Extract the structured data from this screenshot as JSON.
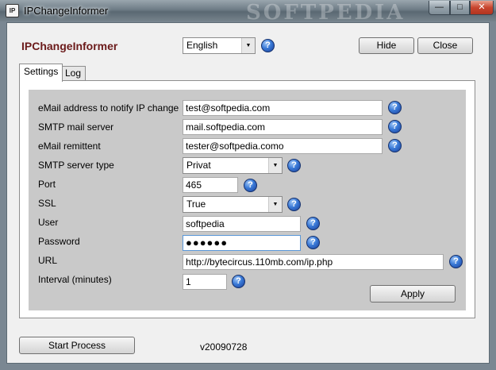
{
  "window": {
    "title": "IPChangeInformer",
    "icon_text": "IP",
    "watermark": "SOFTPEDIA",
    "minimize_glyph": "—",
    "maximize_glyph": "□",
    "close_glyph": "✕"
  },
  "header": {
    "app_title": "IPChangeInformer",
    "language": {
      "selected": "English"
    },
    "hide_label": "Hide",
    "close_label": "Close"
  },
  "tabs": [
    {
      "label": "Settings",
      "active": true
    },
    {
      "label": "Log",
      "active": false
    }
  ],
  "form": {
    "email_notify": {
      "label": "eMail address to notify IP change",
      "value": "test@softpedia.com"
    },
    "smtp_server": {
      "label": "SMTP mail server",
      "value": "mail.softpedia.com"
    },
    "email_remittent": {
      "label": "eMail remittent",
      "value": "tester@softpedia.como"
    },
    "smtp_type": {
      "label": "SMTP server type",
      "selected": "Privat"
    },
    "port": {
      "label": "Port",
      "value": "465"
    },
    "ssl": {
      "label": "SSL",
      "selected": "True"
    },
    "user": {
      "label": "User",
      "value": "softpedia"
    },
    "password": {
      "label": "Password",
      "value": "●●●●●●"
    },
    "url": {
      "label": "URL",
      "value": "http://bytecircus.110mb.com/ip.php"
    },
    "interval": {
      "label": "Interval (minutes)",
      "value": "1"
    },
    "apply_label": "Apply"
  },
  "footer": {
    "start_label": "Start Process",
    "version": "v20090728"
  },
  "icons": {
    "help": "?",
    "dropdown": "▼"
  }
}
